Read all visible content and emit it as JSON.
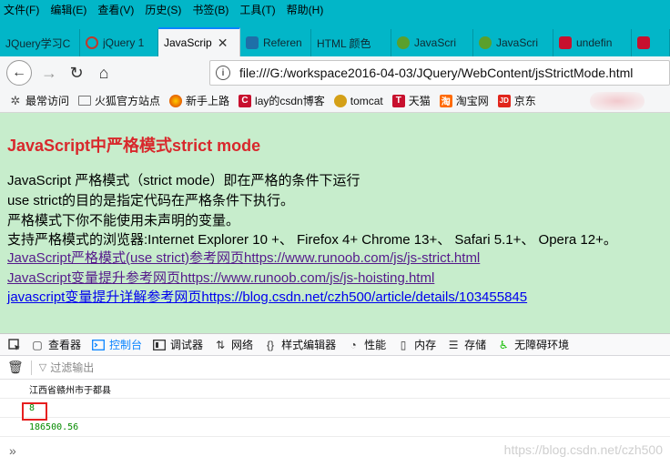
{
  "menu": [
    "文件(F)",
    "编辑(E)",
    "查看(V)",
    "历史(S)",
    "书签(B)",
    "工具(T)",
    "帮助(H)"
  ],
  "tabs": [
    {
      "label": "JQuery学习C",
      "color": "#02b6c8"
    },
    {
      "label": "jQuery 1",
      "color": "#c0392b"
    },
    {
      "label": "JavaScrip",
      "color": "#f5f6f7",
      "active": true
    },
    {
      "label": "Referen",
      "color": "#1e6fa8"
    },
    {
      "label": "HTML 颜色",
      "color": "#02b6c8"
    },
    {
      "label": "JavaScri",
      "color": "#5aa02c"
    },
    {
      "label": "JavaScri",
      "color": "#5aa02c"
    },
    {
      "label": "undefin",
      "color": "#c8102e"
    },
    {
      "label": "",
      "color": "#c8102e"
    }
  ],
  "nav": {
    "url": "file:///G:/workspace2016-04-03/JQuery/WebContent/jsStrictMode.html"
  },
  "bookmarks": [
    {
      "label": "最常访问",
      "icon": "gear-icon",
      "color": "#555555"
    },
    {
      "label": "火狐官方站点",
      "icon": "folder-icon",
      "color": "#777777"
    },
    {
      "label": "新手上路",
      "icon": "firefox-icon",
      "color": "#e66000"
    },
    {
      "label": "lay的csdn博客",
      "icon": "csdn-icon",
      "color": "#c8102e"
    },
    {
      "label": "tomcat",
      "icon": "tomcat-icon",
      "color": "#d4a017"
    },
    {
      "label": "天猫",
      "icon": "tmall-icon",
      "color": "#c8102e"
    },
    {
      "label": "淘宝网",
      "icon": "taobao-icon",
      "color": "#ff6a00"
    },
    {
      "label": "京东",
      "icon": "jd-icon",
      "color": "#e1251b"
    }
  ],
  "page": {
    "title": "JavaScript中严格模式strict mode",
    "lines": [
      "JavaScript 严格模式（strict mode）即在严格的条件下运行",
      "use strict的目的是指定代码在严格条件下执行。",
      "严格模式下你不能使用未声明的变量。",
      "支持严格模式的浏览器:Internet Explorer 10 +、 Firefox 4+ Chrome 13+、 Safari 5.1+、 Opera 12+。"
    ],
    "links": [
      {
        "text": "JavaScript严格模式(use strict)参考网页https://www.runoob.com/js/js-strict.html",
        "visited": true
      },
      {
        "text": "JavaScript变量提升参考网页https://www.runoob.com/js/js-hoisting.html",
        "visited": true
      },
      {
        "text": "javascript变量提升详解参考网页https://blog.csdn.net/czh500/article/details/103455845",
        "visited": false
      }
    ]
  },
  "devtools": {
    "tabs": [
      "查看器",
      "控制台",
      "调试器",
      "网络",
      "样式编辑器",
      "性能",
      "内存",
      "存储",
      "无障碍环境"
    ],
    "active_tab": "控制台",
    "filter_placeholder": "过滤输出",
    "messages": [
      "江西省赣州市于都县",
      "8",
      "186500.56"
    ],
    "prompt": "»"
  },
  "watermark": "https://blog.csdn.net/czh500"
}
